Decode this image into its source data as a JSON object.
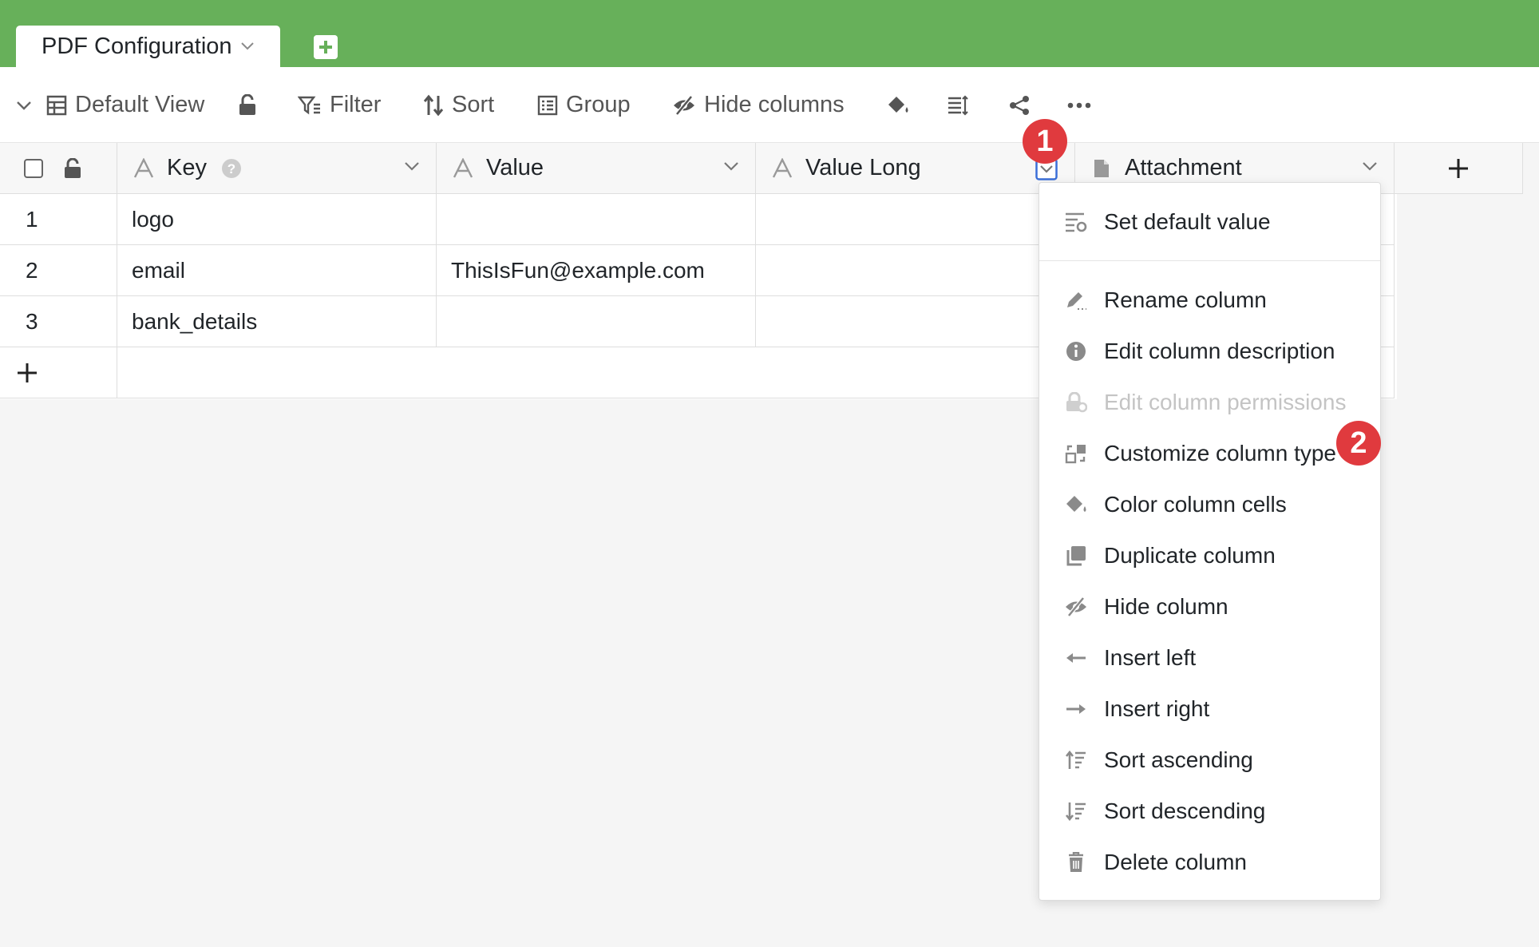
{
  "tab": {
    "title": "PDF Configuration"
  },
  "toolbar": {
    "view_label": "Default View",
    "filter_label": "Filter",
    "sort_label": "Sort",
    "group_label": "Group",
    "hide_columns_label": "Hide columns"
  },
  "columns": [
    {
      "name": "Key",
      "icon": "text-type-icon"
    },
    {
      "name": "Value",
      "icon": "text-type-icon"
    },
    {
      "name": "Value Long",
      "icon": "text-type-icon"
    },
    {
      "name": "Attachment",
      "icon": "file-icon"
    }
  ],
  "rows": [
    {
      "num": "1",
      "key": "logo",
      "value": ""
    },
    {
      "num": "2",
      "key": "email",
      "value": "ThisIsFun@example.com"
    },
    {
      "num": "3",
      "key": "bank_details",
      "value": ""
    }
  ],
  "menu": {
    "items": [
      {
        "label": "Set default value",
        "icon": "default-value-icon",
        "disabled": false
      },
      {
        "label": "Rename column",
        "icon": "pencil-icon",
        "disabled": false
      },
      {
        "label": "Edit column description",
        "icon": "info-icon",
        "disabled": false
      },
      {
        "label": "Edit column permissions",
        "icon": "lock-gear-icon",
        "disabled": true
      },
      {
        "label": "Customize column type",
        "icon": "column-type-icon",
        "disabled": false
      },
      {
        "label": "Color column cells",
        "icon": "paint-bucket-icon",
        "disabled": false
      },
      {
        "label": "Duplicate column",
        "icon": "duplicate-icon",
        "disabled": false
      },
      {
        "label": "Hide column",
        "icon": "eye-off-icon",
        "disabled": false
      },
      {
        "label": "Insert left",
        "icon": "arrow-left-icon",
        "disabled": false
      },
      {
        "label": "Insert right",
        "icon": "arrow-right-icon",
        "disabled": false
      },
      {
        "label": "Sort ascending",
        "icon": "sort-ascending-icon",
        "disabled": false
      },
      {
        "label": "Sort descending",
        "icon": "sort-descending-icon",
        "disabled": false
      },
      {
        "label": "Delete column",
        "icon": "trash-icon",
        "disabled": false
      }
    ]
  },
  "badges": [
    "1",
    "2"
  ],
  "colors": {
    "header_green": "#67b05a",
    "badge_red": "#e03a3e",
    "focus_blue": "#3b6fd8"
  }
}
